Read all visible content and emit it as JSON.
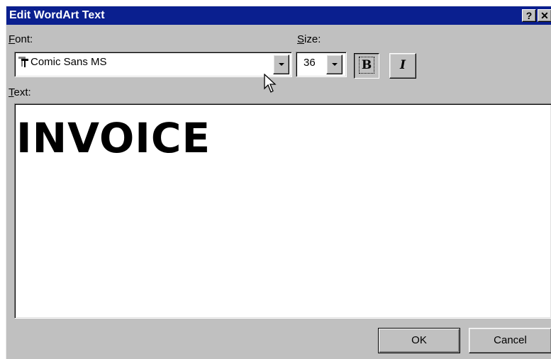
{
  "window": {
    "title": "Edit WordArt Text",
    "help_button": "?",
    "close_button": "✕"
  },
  "font": {
    "label_mnemonic": "F",
    "label_rest": "ont:",
    "value": "Comic Sans MS",
    "icon": "truetype-icon"
  },
  "size": {
    "label_mnemonic": "S",
    "label_rest": "ize:",
    "value": "36"
  },
  "style": {
    "bold_label": "B",
    "italic_label": "I",
    "bold_pressed": true
  },
  "text": {
    "label_mnemonic": "T",
    "label_rest": "ext:",
    "content": "INVOICE"
  },
  "buttons": {
    "ok": "OK",
    "cancel": "Cancel"
  }
}
